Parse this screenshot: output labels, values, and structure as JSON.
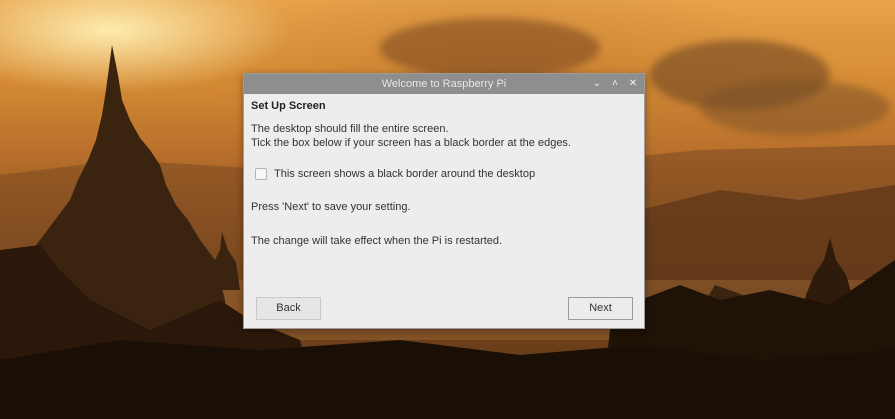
{
  "window": {
    "title": "Welcome to Raspberry Pi",
    "controls": {
      "minimize_icon": "chevron-down-icon",
      "maximize_icon": "chevron-up-icon",
      "close_icon": "close-icon",
      "minimize_glyph": "⌄",
      "maximize_glyph": "˄",
      "close_glyph": "✕"
    }
  },
  "page": {
    "heading": "Set Up Screen",
    "line1": "The desktop should fill the entire screen.",
    "line2": "Tick the box below if your screen has a black border at the edges.",
    "checkbox_label": "This screen shows a black border around the desktop",
    "checkbox_checked": false,
    "next_hint": "Press 'Next' to save your setting.",
    "restart_note": "The change will take effect when the Pi is restarted."
  },
  "buttons": {
    "back": "Back",
    "next": "Next"
  },
  "colors": {
    "titlebar": "#8e8e8e",
    "dialog_bg": "#ededed"
  }
}
